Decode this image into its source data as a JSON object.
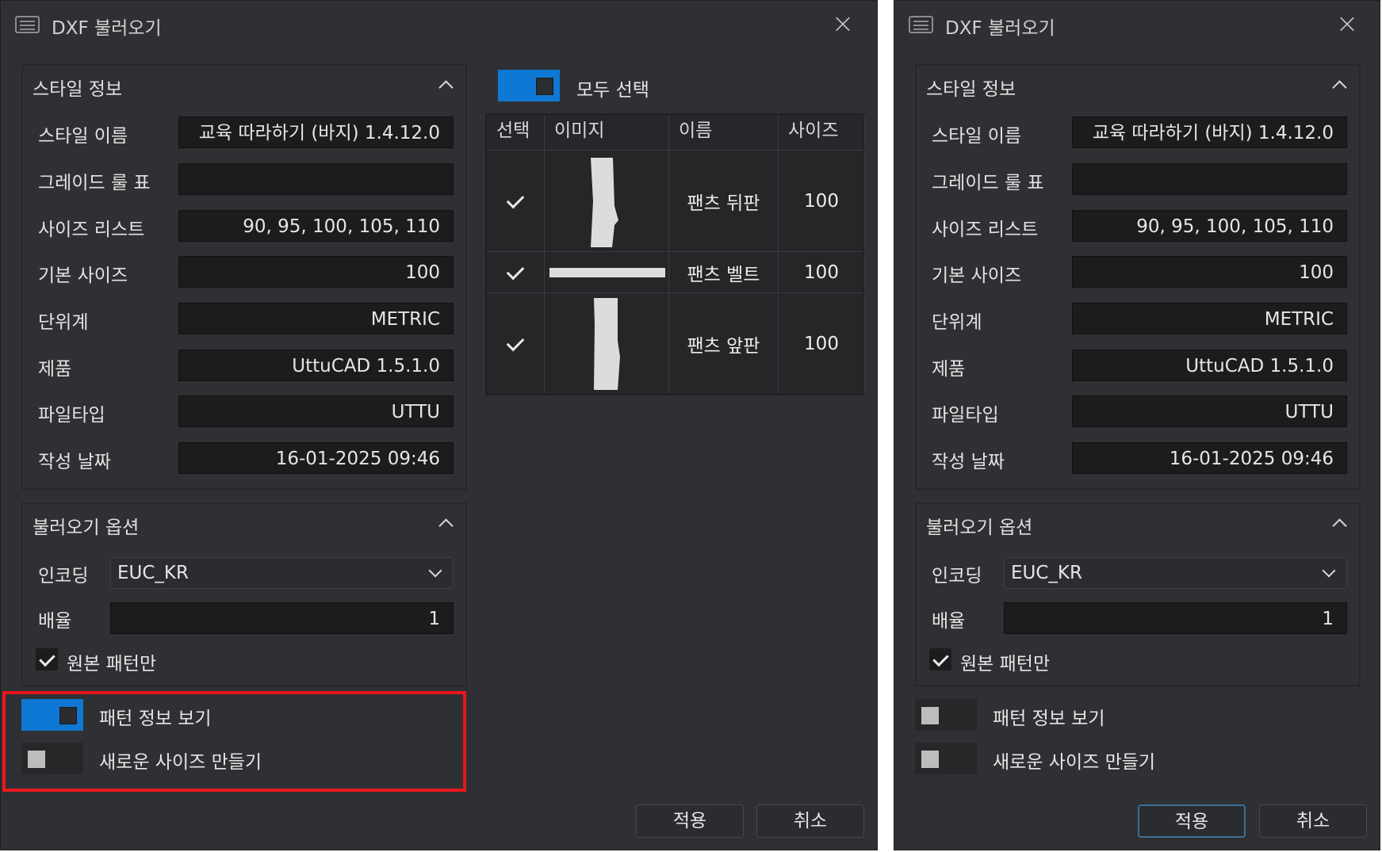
{
  "window_title": "DXF 불러오기",
  "style_panel": {
    "title": "스타일 정보",
    "rows": [
      {
        "label": "스타일 이름",
        "value": "교육 따라하기 (바지) 1.4.12.0"
      },
      {
        "label": "그레이드 룰 표",
        "value": ""
      },
      {
        "label": "사이즈 리스트",
        "value": "90, 95, 100, 105, 110"
      },
      {
        "label": "기본 사이즈",
        "value": "100"
      },
      {
        "label": "단위계",
        "value": "METRIC"
      },
      {
        "label": "제품",
        "value": "UttuCAD 1.5.1.0"
      },
      {
        "label": "파일타입",
        "value": "UTTU"
      },
      {
        "label": "작성 날짜",
        "value": "16-01-2025 09:46"
      }
    ]
  },
  "import_options": {
    "title": "불러오기 옵션",
    "encoding_label": "인코딩",
    "encoding_value": "EUC_KR",
    "scale_label": "배율",
    "scale_value": "1",
    "original_only_label": "원본 패턴만",
    "original_only_checked": true
  },
  "toggles": {
    "show_pattern_info": "패턴 정보 보기",
    "new_size": "새로운 사이즈 만들기"
  },
  "left_state": {
    "show_pattern_info": true,
    "new_size": false
  },
  "right_state": {
    "show_pattern_info": false,
    "new_size": false
  },
  "select_all_label": "모두 선택",
  "pattern_table": {
    "columns": [
      "선택",
      "이미지",
      "이름",
      "사이즈"
    ],
    "rows": [
      {
        "checked": true,
        "image": "back-panel-shape",
        "name": "팬츠 뒤판",
        "size": "100"
      },
      {
        "checked": true,
        "image": "belt-shape",
        "name": "팬츠 벨트",
        "size": "100"
      },
      {
        "checked": true,
        "image": "front-panel-shape",
        "name": "팬츠 앞판",
        "size": "100"
      }
    ]
  },
  "buttons": {
    "apply": "적용",
    "cancel": "취소"
  },
  "colors": {
    "accent": "#0f78d4",
    "highlight": "#e8171e",
    "background": "#2f3033",
    "field": "#1c1c1d"
  }
}
